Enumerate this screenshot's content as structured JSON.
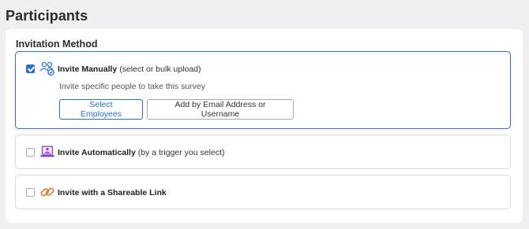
{
  "page": {
    "title": "Participants"
  },
  "invitation": {
    "section_label": "Invitation Method",
    "options": [
      {
        "title": "Invite Manually",
        "subtitle": "(select or bulk upload)",
        "checked": true,
        "icon": "people-check-icon",
        "description": "Invite specific people to take this survey",
        "buttons": [
          "Select Employees",
          "Add by Email Address or Username"
        ]
      },
      {
        "title": "Invite Automatically",
        "subtitle": "(by a trigger you select)",
        "checked": false,
        "icon": "automation-laptop-icon"
      },
      {
        "title": "Invite with a Shareable Link",
        "subtitle": "",
        "checked": false,
        "icon": "link-icon"
      }
    ]
  },
  "colors": {
    "accent": "#2c6fd1",
    "automation_icon": "#8a3fd1",
    "link_icon": "#e8702a",
    "page_bg": "#f0f0f2"
  }
}
